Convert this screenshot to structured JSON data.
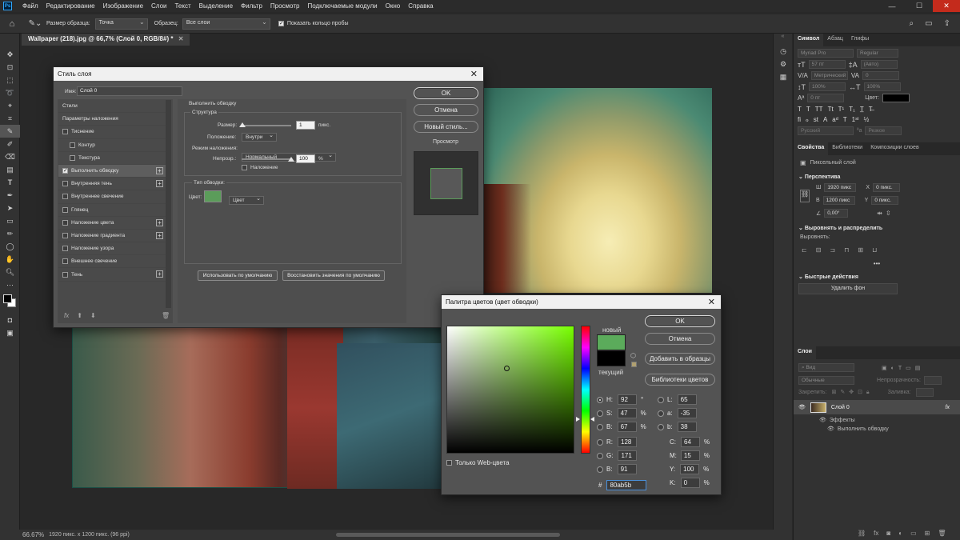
{
  "menubar": {
    "logo": "Ps",
    "items": [
      "Файл",
      "Редактирование",
      "Изображение",
      "Слои",
      "Текст",
      "Выделение",
      "Фильтр",
      "Просмотр",
      "Подключаемые модули",
      "Окно",
      "Справка"
    ]
  },
  "options": {
    "sample_size_label": "Размер образца:",
    "sample_size_value": "Точка",
    "sample_label": "Образец:",
    "sample_value": "Все слои",
    "show_ring_label": "Показать кольцо пробы"
  },
  "document_tab": "Wallpaper (218).jpg @ 66,7% (Слой 0, RGB/8#) *",
  "status": {
    "zoom": "66.67%",
    "info": "1920 пикс. x 1200 пикс. (96 ppi)"
  },
  "layer_style": {
    "title": "Стиль слоя",
    "name_label": "Имя:",
    "name_value": "Слой 0",
    "styles": [
      {
        "label": "Стили",
        "check": false,
        "plus": false,
        "indent": false,
        "header": true
      },
      {
        "label": "Параметры наложения",
        "check": false,
        "plus": false,
        "indent": false,
        "header": true
      },
      {
        "label": "Тиснение",
        "check": true,
        "on": false,
        "plus": false,
        "indent": false
      },
      {
        "label": "Контур",
        "check": true,
        "on": false,
        "plus": false,
        "indent": true
      },
      {
        "label": "Текстура",
        "check": true,
        "on": false,
        "plus": false,
        "indent": true
      },
      {
        "label": "Выполнить обводку",
        "check": true,
        "on": true,
        "plus": true,
        "indent": false,
        "active": true
      },
      {
        "label": "Внутренняя тень",
        "check": true,
        "on": false,
        "plus": true,
        "indent": false
      },
      {
        "label": "Внутреннее свечение",
        "check": true,
        "on": false,
        "plus": false,
        "indent": false
      },
      {
        "label": "Глянец",
        "check": true,
        "on": false,
        "plus": false,
        "indent": false
      },
      {
        "label": "Наложение цвета",
        "check": true,
        "on": false,
        "plus": true,
        "indent": false
      },
      {
        "label": "Наложение градиента",
        "check": true,
        "on": false,
        "plus": true,
        "indent": false
      },
      {
        "label": "Наложение узора",
        "check": true,
        "on": false,
        "plus": false,
        "indent": false
      },
      {
        "label": "Внешнее свечение",
        "check": true,
        "on": false,
        "plus": false,
        "indent": false
      },
      {
        "label": "Тень",
        "check": true,
        "on": false,
        "plus": true,
        "indent": false
      }
    ],
    "footer_fx": "fx",
    "section_title": "Выполнить обводку",
    "structure_title": "Структура",
    "size_label": "Размер:",
    "size_value": "1",
    "size_unit": "пикс.",
    "position_label": "Положение:",
    "position_value": "Внутри",
    "blend_label": "Режим наложения:",
    "blend_value": "Нормальный",
    "opacity_label": "Непрозр.:",
    "opacity_value": "100",
    "opacity_unit": "%",
    "overprint_label": "Наложение",
    "fill_type_label": "Тип обводки:",
    "fill_type_value": "Цвет",
    "color_label": "Цвет:",
    "stroke_color": "#5b9c5a",
    "default_btn": "Использовать по умолчанию",
    "reset_btn": "Восстановить значения по умолчанию",
    "ok": "OK",
    "cancel": "Отмена",
    "new_style": "Новый стиль...",
    "preview": "Просмотр"
  },
  "color_picker": {
    "title": "Палитра цветов (цвет обводки)",
    "ok": "OK",
    "cancel": "Отмена",
    "add_swatches": "Добавить в образцы",
    "color_libraries": "Библиотеки цветов",
    "new_label": "новый",
    "current_label": "текущий",
    "new_color": "#5bab5b",
    "current_color": "#000000",
    "web_only": "Только Web-цвета",
    "H": "92",
    "H_unit": "°",
    "S": "47",
    "S_unit": "%",
    "B": "67",
    "B_unit": "%",
    "R": "128",
    "G": "171",
    "Bl": "91",
    "L": "65",
    "a": "-35",
    "b": "38",
    "C": "64",
    "M": "15",
    "Y": "100",
    "K": "0",
    "pct": "%",
    "hex_label": "#",
    "hex": "80ab5b"
  },
  "right_panel": {
    "char_tabs": [
      "Символ",
      "Абзац",
      "Глифы"
    ],
    "font": "Myriad Pro",
    "style": "Regular",
    "size": "57 пт",
    "leading": "(Авто)",
    "kerning": "Метрический",
    "tracking": "0",
    "vscale": "100%",
    "hscale": "100%",
    "baseline": "0 пт",
    "color_label": "Цвет:",
    "lang": "Русский",
    "aa": "Резкое",
    "prop_tabs": [
      "Свойства",
      "Библиотеки",
      "Композиции слоев"
    ],
    "pixel_layer": "Пиксельный слой",
    "perspective": "Перспектива",
    "w_label": "Ш",
    "w": "1920 пикс",
    "x_label": "X",
    "x": "0 пикс.",
    "h_label": "В",
    "h": "1200 пикс",
    "y_label": "Y",
    "y": "0 пикс.",
    "angle": "0,00°",
    "align_title": "Выровнять и распределить",
    "align_label": "Выровнять:",
    "quick_title": "Быстрые действия",
    "remove_bg": "Удалить фон",
    "layers_tab": "Слои",
    "search": "Вид",
    "blend": "Обычные",
    "opacity_label": "Непрозрачность:",
    "lock_label": "Закрепить:",
    "fill_label": "Заливка:",
    "layer_name": "Слой 0",
    "fx": "fx",
    "effects": "Эффекты",
    "effect_item": "Выполнить обводку"
  }
}
